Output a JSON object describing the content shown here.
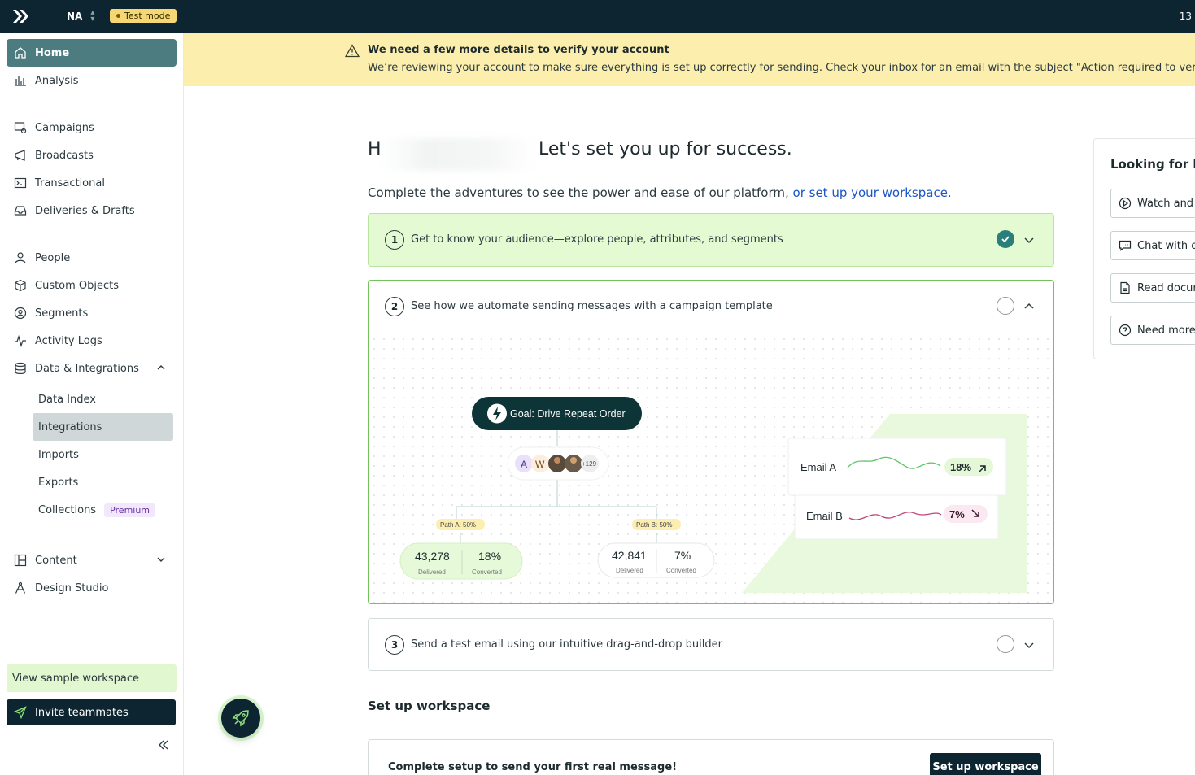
{
  "topbar": {
    "workspace_code": "NA",
    "test_mode_label": "Test mode",
    "right_count": "13"
  },
  "sidebar": {
    "items": [
      {
        "label": "Home",
        "icon": "home-icon"
      },
      {
        "label": "Analysis",
        "icon": "bar-chart-icon"
      },
      {
        "label": "Campaigns",
        "icon": "campaign-icon"
      },
      {
        "label": "Broadcasts",
        "icon": "megaphone-icon"
      },
      {
        "label": "Transactional",
        "icon": "terminal-icon"
      },
      {
        "label": "Deliveries & Drafts",
        "icon": "inbox-icon"
      },
      {
        "label": "People",
        "icon": "person-icon"
      },
      {
        "label": "Custom Objects",
        "icon": "cube-icon"
      },
      {
        "label": "Segments",
        "icon": "segment-icon"
      },
      {
        "label": "Activity Logs",
        "icon": "pulse-icon"
      },
      {
        "label": "Data & Integrations",
        "icon": "database-icon"
      }
    ],
    "sub_items": [
      {
        "label": "Data Index"
      },
      {
        "label": "Integrations"
      },
      {
        "label": "Imports"
      },
      {
        "label": "Exports"
      },
      {
        "label": "Collections",
        "badge": "Premium"
      }
    ],
    "bottom_items": [
      {
        "label": "Content",
        "icon": "layout-icon"
      },
      {
        "label": "Design Studio",
        "icon": "compass-icon"
      }
    ],
    "sample_workspace": "View sample workspace",
    "invite": "Invite teammates"
  },
  "banner": {
    "title": "We need a few more details to verify your account",
    "text": "We’re reviewing your account to make sure everything is set up correctly for sending. Check your inbox for an email with the subject \"Action required to verify your C"
  },
  "main": {
    "greeting": "H",
    "headline": "Let's set you up for success.",
    "intro_text": "Complete the adventures to see the power and ease of our platform, ",
    "intro_link": "or set up your workspace.",
    "steps": [
      {
        "number": "1",
        "label": "Get to know your audience—explore people, attributes, and segments"
      },
      {
        "number": "2",
        "label": "See how we automate sending messages with a campaign template"
      },
      {
        "number": "3",
        "label": "Send a test email using our intuitive drag-and-drop builder"
      }
    ],
    "illustration": {
      "goal": "Goal: Drive Repeat Order",
      "avatars": [
        "A",
        "W"
      ],
      "avatar_more": "+129",
      "path_a": "Path A: 50%",
      "path_b": "Path B: 50%",
      "card_a": {
        "delivered": "43,278",
        "delivered_label": "Delivered",
        "converted": "18%",
        "converted_label": "Converted"
      },
      "card_b": {
        "delivered": "42,841",
        "delivered_label": "Delivered",
        "converted": "7%",
        "converted_label": "Converted"
      },
      "email_a": {
        "name": "Email A",
        "rate": "18%"
      },
      "email_b": {
        "name": "Email B",
        "rate": "7%"
      }
    },
    "section_title": "Set up workspace",
    "setup_text": "Complete setup to send your first real message!",
    "setup_button": "Set up workspace"
  },
  "help": {
    "title": "Looking for he",
    "buttons": [
      {
        "label": "Watch and",
        "icon": "play-icon"
      },
      {
        "label": "Chat with o",
        "icon": "chat-icon"
      },
      {
        "label": "Read docur",
        "icon": "document-icon"
      },
      {
        "label": "Need more",
        "icon": "question-icon"
      }
    ]
  }
}
